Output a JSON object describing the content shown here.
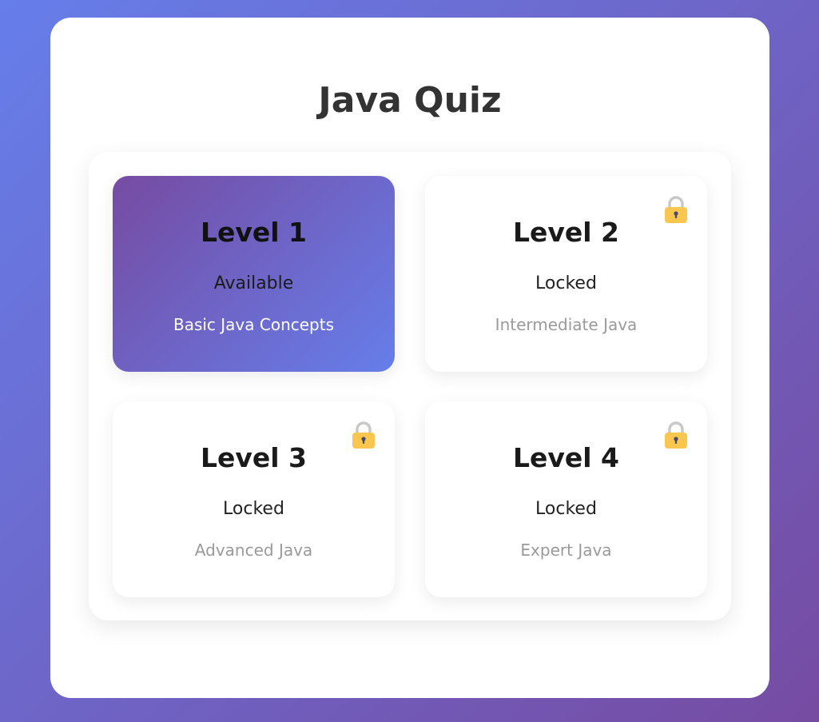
{
  "app": {
    "title": "Java Quiz"
  },
  "levels": [
    {
      "name": "Level 1",
      "status": "Available",
      "description": "Basic Java Concepts",
      "locked": false
    },
    {
      "name": "Level 2",
      "status": "Locked",
      "description": "Intermediate Java",
      "locked": true,
      "icon": "lock-icon"
    },
    {
      "name": "Level 3",
      "status": "Locked",
      "description": "Advanced Java",
      "locked": true,
      "icon": "lock-icon"
    },
    {
      "name": "Level 4",
      "status": "Locked",
      "description": "Expert Java",
      "locked": true,
      "icon": "lock-icon"
    }
  ],
  "colors": {
    "background_gradient": [
      "#667eea",
      "#764ba2"
    ],
    "available_card_gradient": [
      "#764ba2",
      "#667eea"
    ],
    "lock_body": "#f9c74f",
    "lock_shackle": "#c8c8c8",
    "title_text": "#333333"
  }
}
